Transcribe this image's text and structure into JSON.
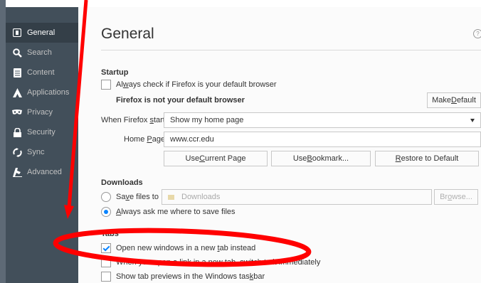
{
  "sidebar": {
    "items": [
      {
        "label": "General",
        "icon": "general-icon"
      },
      {
        "label": "Search",
        "icon": "search-icon"
      },
      {
        "label": "Content",
        "icon": "content-icon"
      },
      {
        "label": "Applications",
        "icon": "applications-icon"
      },
      {
        "label": "Privacy",
        "icon": "privacy-mask-icon"
      },
      {
        "label": "Security",
        "icon": "lock-icon"
      },
      {
        "label": "Sync",
        "icon": "sync-icon"
      },
      {
        "label": "Advanced",
        "icon": "advanced-icon"
      }
    ],
    "selected": "General"
  },
  "page": {
    "title": "General",
    "help_glyph": "?"
  },
  "startup": {
    "title": "Startup",
    "always_check": {
      "pre": "Al",
      "u": "w",
      "post": "ays check if Firefox is your default browser",
      "checked": false
    },
    "status": "Firefox is not your default browser",
    "make_default": {
      "pre": "Make ",
      "u": "D",
      "post": "efault"
    },
    "when_starts": {
      "pre": "When Firefox ",
      "u": "s",
      "post": "tarts:"
    },
    "when_starts_value": "Show my home page",
    "home_page": {
      "pre": "Home ",
      "u": "P",
      "post": "age:"
    },
    "home_page_value": "www.ccr.edu",
    "use_current": {
      "pre": "Use ",
      "u": "C",
      "post": "urrent Page"
    },
    "use_bookmark": {
      "pre": "Use ",
      "u": "B",
      "post": "ookmark..."
    },
    "restore_default": {
      "pre": "",
      "u": "R",
      "post": "estore to Default"
    }
  },
  "downloads": {
    "title": "Downloads",
    "save_files": {
      "pre": "Sa",
      "u": "v",
      "post": "e files to",
      "checked": false
    },
    "folder": "Downloads",
    "browse": {
      "pre": "Br",
      "u": "o",
      "post": "wse..."
    },
    "always_ask": {
      "pre": "",
      "u": "A",
      "post": "lways ask me where to save files",
      "checked": true
    }
  },
  "tabs": {
    "title": "Tabs",
    "open_new_windows": {
      "pre": "Open new windows in a new ",
      "u": "t",
      "post": "ab instead",
      "checked": true
    },
    "switch_to_tab": {
      "text": "When you open a link in a new tab, switch to it immediately",
      "checked": false
    },
    "tab_previews": {
      "pre": "Show tab previews in the Windows tas",
      "u": "k",
      "post": "bar",
      "checked": false
    }
  },
  "annotation_color": "#ff0000"
}
